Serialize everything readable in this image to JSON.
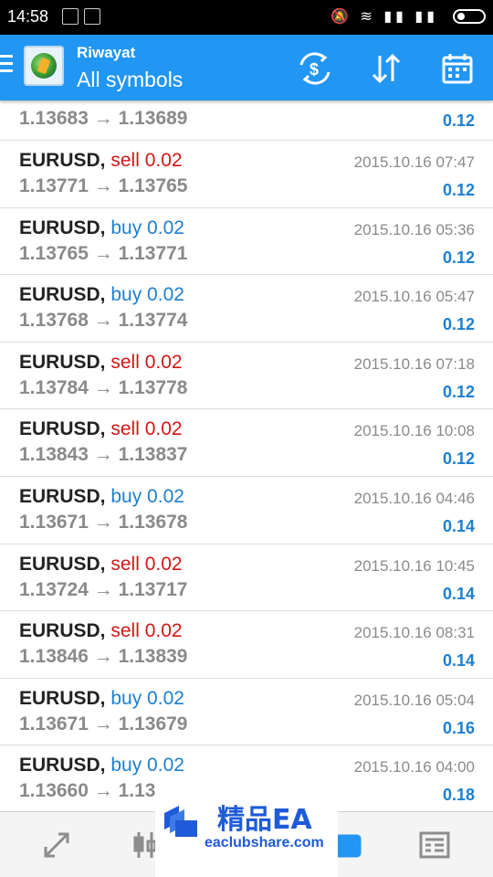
{
  "status_bar": {
    "time": "14:58"
  },
  "app_bar": {
    "title": "Riwayat",
    "subtitle": "All symbols",
    "icons": [
      "menu-icon",
      "app-logo",
      "currency-exchange-icon",
      "sort-icon",
      "calendar-icon"
    ]
  },
  "partial_row": {
    "prices": "1.13683 → 1.13689",
    "profit": "0.12"
  },
  "rows": [
    {
      "symbol": "EURUSD,",
      "side": "sell 0.02",
      "type": "sell",
      "prices": "1.13771 → 1.13765",
      "time": "2015.10.16 07:47",
      "profit": "0.12"
    },
    {
      "symbol": "EURUSD,",
      "side": "buy 0.02",
      "type": "buy",
      "prices": "1.13765 → 1.13771",
      "time": "2015.10.16 05:36",
      "profit": "0.12"
    },
    {
      "symbol": "EURUSD,",
      "side": "buy 0.02",
      "type": "buy",
      "prices": "1.13768 → 1.13774",
      "time": "2015.10.16 05:47",
      "profit": "0.12"
    },
    {
      "symbol": "EURUSD,",
      "side": "sell 0.02",
      "type": "sell",
      "prices": "1.13784 → 1.13778",
      "time": "2015.10.16 07:18",
      "profit": "0.12"
    },
    {
      "symbol": "EURUSD,",
      "side": "sell 0.02",
      "type": "sell",
      "prices": "1.13843 → 1.13837",
      "time": "2015.10.16 10:08",
      "profit": "0.12"
    },
    {
      "symbol": "EURUSD,",
      "side": "buy 0.02",
      "type": "buy",
      "prices": "1.13671 → 1.13678",
      "time": "2015.10.16 04:46",
      "profit": "0.14"
    },
    {
      "symbol": "EURUSD,",
      "side": "sell 0.02",
      "type": "sell",
      "prices": "1.13724 → 1.13717",
      "time": "2015.10.16 10:45",
      "profit": "0.14"
    },
    {
      "symbol": "EURUSD,",
      "side": "sell 0.02",
      "type": "sell",
      "prices": "1.13846 → 1.13839",
      "time": "2015.10.16 08:31",
      "profit": "0.14"
    },
    {
      "symbol": "EURUSD,",
      "side": "buy 0.02",
      "type": "buy",
      "prices": "1.13671 → 1.13679",
      "time": "2015.10.16 05:04",
      "profit": "0.16"
    },
    {
      "symbol": "EURUSD,",
      "side": "buy 0.02",
      "type": "buy",
      "prices": "1.13660 → 1.13",
      "time": "2015.10.16 04:00",
      "profit": "0.18"
    }
  ],
  "bottom_nav": {
    "icons": [
      "trade-icon",
      "chart-icon",
      "history-icon",
      "news-icon"
    ]
  },
  "watermark": {
    "cn": "精品EA",
    "url": "eaclubshare.com"
  },
  "colors": {
    "accent": "#2196f3",
    "buy": "#1e7fd0",
    "sell": "#d01717",
    "profit": "#1e7fd0"
  }
}
